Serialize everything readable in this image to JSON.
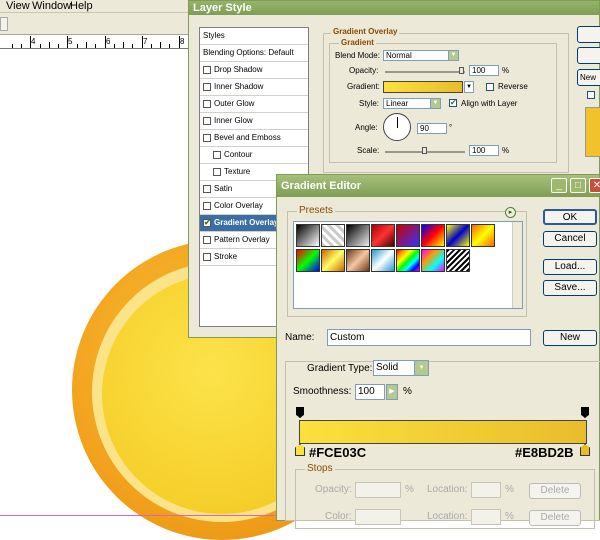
{
  "menu": {
    "view": "View",
    "window": "Window",
    "help": "Help"
  },
  "ruler": {
    "labels": [
      "4",
      "5",
      "6",
      "7",
      "8"
    ]
  },
  "layer_style": {
    "title": "Layer Style",
    "list": [
      {
        "label": "Styles",
        "type": "header"
      },
      {
        "label": "Blending Options: Default",
        "type": "header"
      },
      {
        "label": "Drop Shadow",
        "checked": false
      },
      {
        "label": "Inner Shadow",
        "checked": false
      },
      {
        "label": "Outer Glow",
        "checked": false
      },
      {
        "label": "Inner Glow",
        "checked": false
      },
      {
        "label": "Bevel and Emboss",
        "checked": false
      },
      {
        "label": "Contour",
        "checked": false,
        "sub": true
      },
      {
        "label": "Texture",
        "checked": false,
        "sub": true
      },
      {
        "label": "Satin",
        "checked": false
      },
      {
        "label": "Color Overlay",
        "checked": false
      },
      {
        "label": "Gradient Overlay",
        "checked": true,
        "selected": true
      },
      {
        "label": "Pattern Overlay",
        "checked": false
      },
      {
        "label": "Stroke",
        "checked": false
      }
    ],
    "section_title": "Gradient Overlay",
    "subsection_title": "Gradient",
    "blend_mode_label": "Blend Mode:",
    "blend_mode_value": "Normal",
    "opacity_label": "Opacity:",
    "opacity_value": "100",
    "opacity_unit": "%",
    "opacity_level": 1.0,
    "gradient_label": "Gradient:",
    "reverse_label": "Reverse",
    "reverse_checked": false,
    "style_label": "Style:",
    "style_value": "Linear",
    "align_label": "Align with Layer",
    "align_checked": true,
    "angle_label": "Angle:",
    "angle_value": "90",
    "angle_unit": "°",
    "scale_label": "Scale:",
    "scale_value": "100",
    "scale_unit": "%",
    "scale_level": 0.5,
    "new_button": "New"
  },
  "gradient_editor": {
    "title": "Gradient Editor",
    "presets_label": "Presets",
    "ok_button": "OK",
    "cancel_button": "Cancel",
    "load_button": "Load...",
    "save_button": "Save...",
    "name_label": "Name:",
    "name_value": "Custom",
    "new_button": "New",
    "gradient_type_label": "Gradient Type:",
    "gradient_type_value": "Solid",
    "smoothness_label": "Smoothness:",
    "smoothness_value": "100",
    "smoothness_unit": "%",
    "stop_left_hex": "#FCE03C",
    "stop_right_hex": "#E8BD2B",
    "stops_label": "Stops",
    "opacity_label": "Opacity:",
    "opacity_unit": "%",
    "location_label": "Location:",
    "location_unit": "%",
    "delete_button": "Delete",
    "color_label": "Color:",
    "location_label_2": "Location:",
    "location_unit_2": "%",
    "delete_button_2": "Delete"
  },
  "colors": {
    "gradient_start": "#FCE03C",
    "gradient_end": "#E8BD2B",
    "title_green": "#7f9d55"
  }
}
